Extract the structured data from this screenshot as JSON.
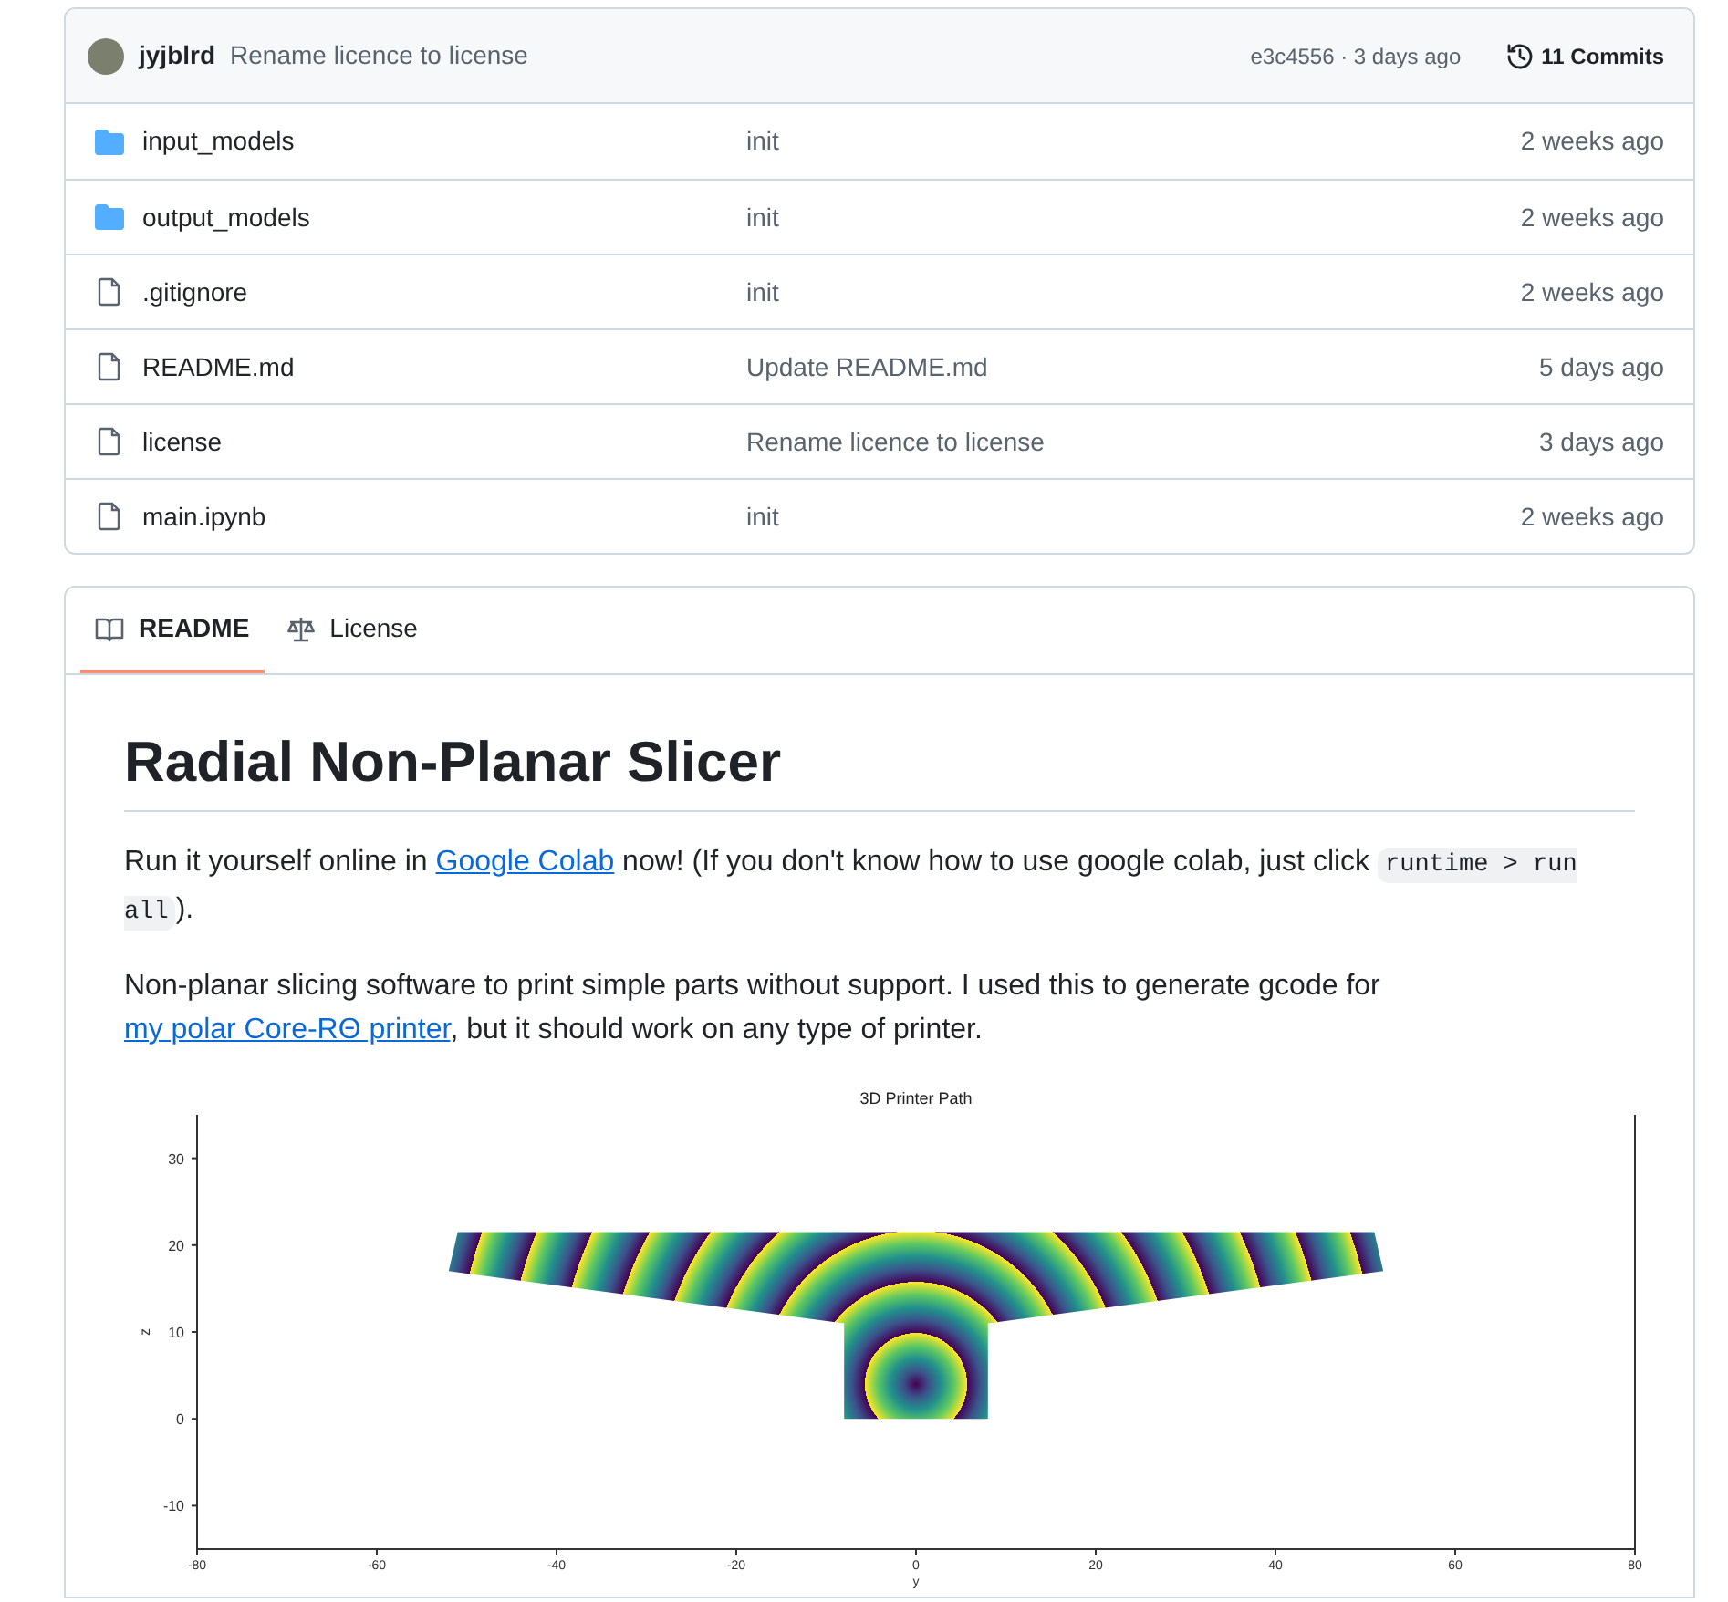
{
  "commit_bar": {
    "author": "jyjblrd",
    "message": "Rename licence to license",
    "hash_time": "e3c4556 · 3 days ago",
    "commits": "11 Commits"
  },
  "files": [
    {
      "kind": "folder",
      "name": "input_models",
      "message": "init",
      "time": "2 weeks ago"
    },
    {
      "kind": "folder",
      "name": "output_models",
      "message": "init",
      "time": "2 weeks ago"
    },
    {
      "kind": "file",
      "name": ".gitignore",
      "message": "init",
      "time": "2 weeks ago"
    },
    {
      "kind": "file",
      "name": "README.md",
      "message": "Update README.md",
      "time": "5 days ago"
    },
    {
      "kind": "file",
      "name": "license",
      "message": "Rename licence to license",
      "time": "3 days ago"
    },
    {
      "kind": "file",
      "name": "main.ipynb",
      "message": "init",
      "time": "2 weeks ago"
    }
  ],
  "tabs": [
    {
      "kind": "book",
      "label": "README",
      "selected": true
    },
    {
      "kind": "scale",
      "label": "License",
      "selected": false
    }
  ],
  "readme": {
    "title": "Radial Non-Planar Slicer",
    "paragraphs": [
      [
        {
          "kind": "text",
          "text": "Run it yourself online in "
        },
        {
          "kind": "link",
          "text": "Google Colab"
        },
        {
          "kind": "text",
          "text": " now! (If you don't know how to use google colab, just click "
        },
        {
          "kind": "code",
          "text": "runtime > run all"
        },
        {
          "kind": "text",
          "text": ")."
        }
      ],
      [
        {
          "kind": "text",
          "text": "Non-planar slicing software to print simple parts without support. I used this to generate gcode for "
        },
        {
          "kind": "link",
          "text": "my polar Core-RΘ printer"
        },
        {
          "kind": "text",
          "text": ", but it should work on any type of printer."
        }
      ]
    ],
    "figure": {
      "title": "3D Printer Path",
      "xlabel": "y",
      "ylabel": "z",
      "xticks": [
        "-80",
        "-60",
        "-40",
        "-20",
        "0",
        "20",
        "40",
        "60",
        "80"
      ],
      "yticks": [
        "30",
        "20",
        "10",
        "0",
        "-10"
      ]
    }
  }
}
